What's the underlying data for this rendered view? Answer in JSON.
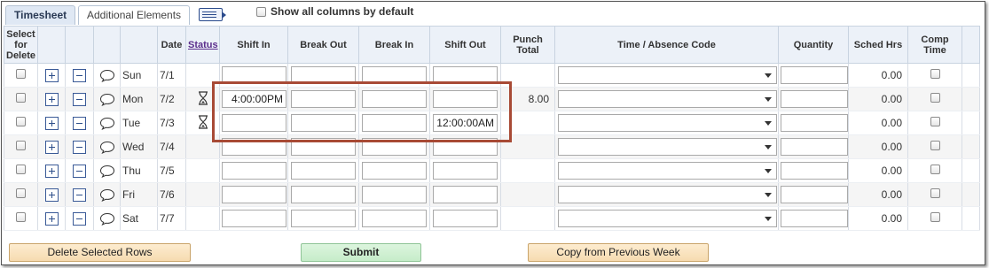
{
  "tabs": [
    {
      "label": "Timesheet",
      "active": true
    },
    {
      "label": "Additional Elements",
      "active": false
    }
  ],
  "show_all_label": "Show all columns by default",
  "headers": {
    "select_delete": "Select for Delete",
    "date": "Date",
    "status": "Status",
    "shift_in": "Shift In",
    "break_out": "Break Out",
    "break_in": "Break In",
    "shift_out": "Shift Out",
    "punch_total": "Punch Total",
    "time_absence_code": "Time / Absence Code",
    "quantity": "Quantity",
    "sched_hrs": "Sched Hrs",
    "comp_time": "Comp Time"
  },
  "rows": [
    {
      "day": "Sun",
      "date": "7/1",
      "status_icon": "",
      "shift_in": "",
      "break_out": "",
      "break_in": "",
      "shift_out": "",
      "punch_total": "",
      "quantity": "",
      "sched_hrs": "0.00"
    },
    {
      "day": "Mon",
      "date": "7/2",
      "status_icon": "hourglass-icon",
      "shift_in": "4:00:00PM",
      "break_out": "",
      "break_in": "",
      "shift_out": "",
      "punch_total": "8.00",
      "quantity": "",
      "sched_hrs": "0.00"
    },
    {
      "day": "Tue",
      "date": "7/3",
      "status_icon": "hourglass-icon",
      "shift_in": "",
      "break_out": "",
      "break_in": "",
      "shift_out": "12:00:00AM",
      "punch_total": "",
      "quantity": "",
      "sched_hrs": "0.00"
    },
    {
      "day": "Wed",
      "date": "7/4",
      "status_icon": "",
      "shift_in": "",
      "break_out": "",
      "break_in": "",
      "shift_out": "",
      "punch_total": "",
      "quantity": "",
      "sched_hrs": "0.00"
    },
    {
      "day": "Thu",
      "date": "7/5",
      "status_icon": "",
      "shift_in": "",
      "break_out": "",
      "break_in": "",
      "shift_out": "",
      "punch_total": "",
      "quantity": "",
      "sched_hrs": "0.00"
    },
    {
      "day": "Fri",
      "date": "7/6",
      "status_icon": "",
      "shift_in": "",
      "break_out": "",
      "break_in": "",
      "shift_out": "",
      "punch_total": "",
      "quantity": "",
      "sched_hrs": "0.00"
    },
    {
      "day": "Sat",
      "date": "7/7",
      "status_icon": "",
      "shift_in": "",
      "break_out": "",
      "break_in": "",
      "shift_out": "",
      "punch_total": "",
      "quantity": "",
      "sched_hrs": "0.00"
    }
  ],
  "buttons": {
    "delete": "Delete Selected Rows",
    "submit": "Submit",
    "copy": "Copy from Previous Week"
  },
  "colors": {
    "header_bg": "#ecf1f8",
    "highlight_border": "#a84a35",
    "status_link": "#5b2e8c"
  }
}
